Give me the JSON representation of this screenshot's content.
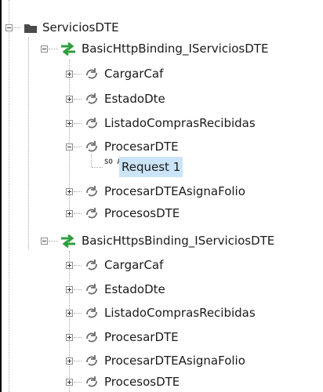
{
  "tree": {
    "root": {
      "label": "ServiciosDTE",
      "icon": "folder-icon"
    },
    "bindings": [
      {
        "label": "BasicHttpBinding_IServiciosDTE",
        "icon": "binding-arrows-icon",
        "operations": [
          {
            "label": "CargarCaf",
            "icon": "operation-icon",
            "expanded": false
          },
          {
            "label": "EstadoDte",
            "icon": "operation-icon",
            "expanded": false
          },
          {
            "label": "ListadoComprasRecibidas",
            "icon": "operation-icon",
            "expanded": false
          },
          {
            "label": "ProcesarDTE",
            "icon": "operation-icon",
            "expanded": true,
            "requests": [
              {
                "label": "Request 1",
                "icon": "soap-icon",
                "icon_text": "SO AP",
                "selected": true
              }
            ]
          },
          {
            "label": "ProcesarDTEAsignaFolio",
            "icon": "operation-icon",
            "expanded": false
          },
          {
            "label": "ProcesosDTE",
            "icon": "operation-icon",
            "expanded": false
          }
        ]
      },
      {
        "label": "BasicHttpsBinding_IServiciosDTE",
        "icon": "binding-arrows-icon",
        "operations": [
          {
            "label": "CargarCaf",
            "icon": "operation-icon",
            "expanded": false
          },
          {
            "label": "EstadoDte",
            "icon": "operation-icon",
            "expanded": false
          },
          {
            "label": "ListadoComprasRecibidas",
            "icon": "operation-icon",
            "expanded": false
          },
          {
            "label": "ProcesarDTE",
            "icon": "operation-icon",
            "expanded": false
          },
          {
            "label": "ProcesarDTEAsignaFolio",
            "icon": "operation-icon",
            "expanded": false
          },
          {
            "label": "ProcesosDTE",
            "icon": "operation-icon",
            "expanded": false
          }
        ]
      }
    ]
  },
  "colors": {
    "selection": "#cce4f7",
    "binding_icon": "#2e9e3e",
    "folder": "#4a4a4a"
  }
}
